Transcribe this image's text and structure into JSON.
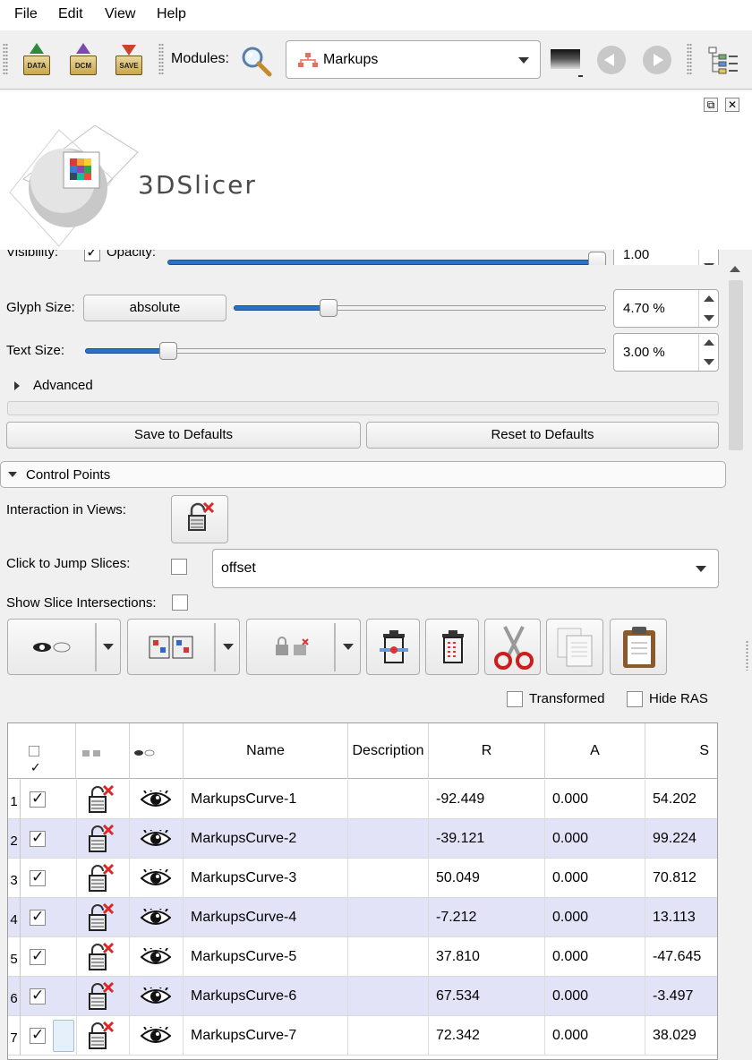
{
  "menu": [
    "File",
    "Edit",
    "View",
    "Help"
  ],
  "toolbar": {
    "data_label": "DATA",
    "dcm_label": "DCM",
    "save_label": "SAVE",
    "modules_label": "Modules:",
    "module_selected": "Markups"
  },
  "logo_text": "3DSlicer",
  "display": {
    "visibility_label": "Visibility:",
    "opacity_label": "Opacity:",
    "opacity_value": "1.00",
    "glyph_size_label": "Glyph Size:",
    "glyph_mode": "absolute",
    "glyph_size_value": "4.70 %",
    "glyph_slider_fraction": 0.25,
    "text_size_label": "Text Size:",
    "text_size_value": "3.00 %",
    "text_slider_fraction": 0.16,
    "advanced_label": "Advanced",
    "save_defaults": "Save to Defaults",
    "reset_defaults": "Reset to Defaults"
  },
  "control_points": {
    "header": "Control Points",
    "interaction_label": "Interaction in Views:",
    "jump_label": "Click to Jump Slices:",
    "jump_mode": "offset",
    "slice_intersections_label": "Show Slice Intersections:",
    "transformed_label": "Transformed",
    "hide_ras_label": "Hide RAS"
  },
  "table": {
    "columns": [
      "Name",
      "Description",
      "R",
      "A",
      "S"
    ],
    "rows": [
      {
        "num": "1",
        "name": "MarkupsCurve-1",
        "r": "-92.449",
        "a": "0.000",
        "s": "54.202"
      },
      {
        "num": "2",
        "name": "MarkupsCurve-2",
        "r": "-39.121",
        "a": "0.000",
        "s": "99.224"
      },
      {
        "num": "3",
        "name": "MarkupsCurve-3",
        "r": "50.049",
        "a": "0.000",
        "s": "70.812"
      },
      {
        "num": "4",
        "name": "MarkupsCurve-4",
        "r": "-7.212",
        "a": "0.000",
        "s": "13.113"
      },
      {
        "num": "5",
        "name": "MarkupsCurve-5",
        "r": "37.810",
        "a": "0.000",
        "s": "-47.645"
      },
      {
        "num": "6",
        "name": "MarkupsCurve-6",
        "r": "67.534",
        "a": "0.000",
        "s": "-3.497"
      },
      {
        "num": "7",
        "name": "MarkupsCurve-7",
        "r": "72.342",
        "a": "0.000",
        "s": "38.029"
      }
    ]
  },
  "colors": {
    "slider_blue": "#2a72c6",
    "row_alt": "#e3e3f8"
  }
}
